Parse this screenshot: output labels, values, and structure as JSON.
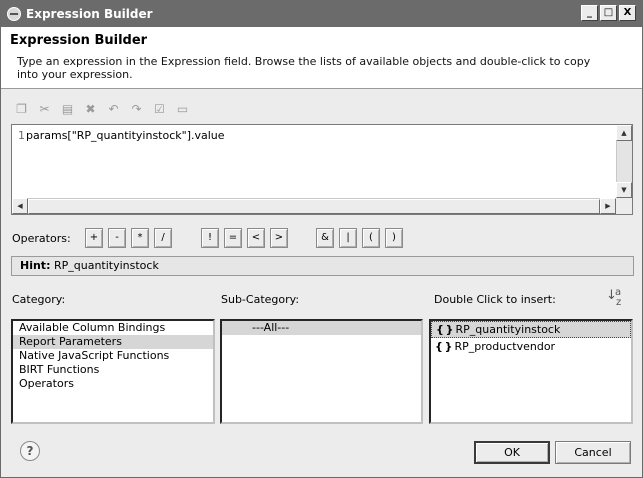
{
  "window": {
    "title": "Expression Builder",
    "controls": {
      "minimize": "_",
      "maximize": "□",
      "close": "X"
    }
  },
  "header": {
    "title": "Expression Builder",
    "description": "Type an expression in the Expression field. Browse the lists of available objects and double-click to copy into your expression."
  },
  "toolbar": {
    "icons": [
      "copy-icon",
      "cut-icon",
      "paste-icon",
      "delete-icon",
      "undo-icon",
      "redo-icon",
      "select-all-icon",
      "validate-icon"
    ],
    "glyphs": [
      "❐",
      "✂",
      "▤",
      "✖",
      "↶",
      "↷",
      "☑",
      "▭"
    ]
  },
  "editor": {
    "line_number": "1",
    "expression": "params[\"RP_quantityinstock\"].value"
  },
  "operators": {
    "label": "Operators:",
    "buttons": [
      "+",
      "-",
      "*",
      "/",
      "!",
      "=",
      "<",
      ">",
      "&",
      "|",
      "(",
      ")"
    ]
  },
  "hint": {
    "key": "Hint:",
    "value": "RP_quantityinstock"
  },
  "category": {
    "label": "Category:",
    "items": [
      "Available Column Bindings",
      "Report Parameters",
      "Native JavaScript Functions",
      "BIRT Functions",
      "Operators"
    ],
    "selected_index": 1
  },
  "subcategory": {
    "label": "Sub-Category:",
    "items": [
      "---All---"
    ],
    "selected_index": 0
  },
  "insert": {
    "label": "Double Click to insert:",
    "sort_glyph": "↓a z",
    "items": [
      "RP_quantityinstock",
      "RP_productvendor"
    ],
    "brace_glyph": "{ }",
    "selected_index": 0
  },
  "footer": {
    "help_glyph": "?",
    "ok_label": "OK",
    "cancel_label": "Cancel"
  }
}
